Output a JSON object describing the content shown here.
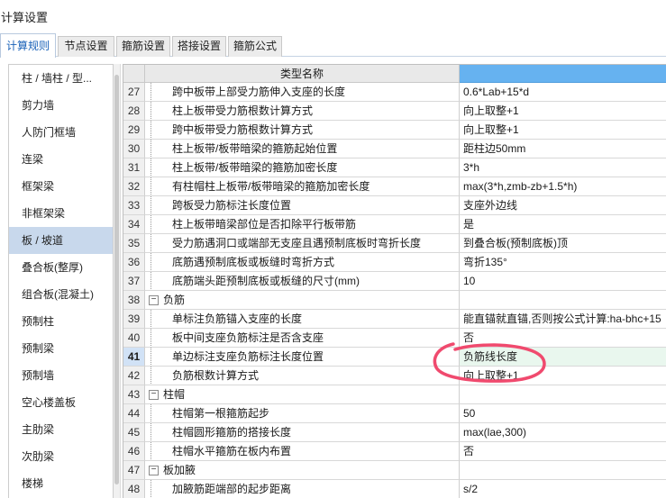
{
  "window": {
    "title": "计算设置"
  },
  "tabs": [
    {
      "label": "计算规则",
      "active": true
    },
    {
      "label": "节点设置",
      "active": false
    },
    {
      "label": "箍筋设置",
      "active": false
    },
    {
      "label": "搭接设置",
      "active": false
    },
    {
      "label": "箍筋公式",
      "active": false
    }
  ],
  "sidebar": {
    "items": [
      {
        "label": "柱 / 墙柱 / 型..."
      },
      {
        "label": "剪力墙"
      },
      {
        "label": "人防门框墙"
      },
      {
        "label": "连梁"
      },
      {
        "label": "框架梁"
      },
      {
        "label": "非框架梁"
      },
      {
        "label": "板 / 坡道",
        "selected": true
      },
      {
        "label": "叠合板(整厚)"
      },
      {
        "label": "组合板(混凝土)"
      },
      {
        "label": "预制柱"
      },
      {
        "label": "预制梁"
      },
      {
        "label": "预制墙"
      },
      {
        "label": "空心楼盖板"
      },
      {
        "label": "主肋梁"
      },
      {
        "label": "次肋梁"
      },
      {
        "label": "楼梯"
      }
    ]
  },
  "grid": {
    "header": {
      "name": "类型名称",
      "value": ""
    },
    "rows": [
      {
        "num": "27",
        "name": "跨中板带上部受力筋伸入支座的长度",
        "value": "0.6*Lab+15*d"
      },
      {
        "num": "28",
        "name": "柱上板带受力筋根数计算方式",
        "value": "向上取整+1"
      },
      {
        "num": "29",
        "name": "跨中板带受力筋根数计算方式",
        "value": "向上取整+1"
      },
      {
        "num": "30",
        "name": "柱上板带/板带暗梁的箍筋起始位置",
        "value": "距柱边50mm"
      },
      {
        "num": "31",
        "name": "柱上板带/板带暗梁的箍筋加密长度",
        "value": "3*h"
      },
      {
        "num": "32",
        "name": "有柱帽柱上板带/板带暗梁的箍筋加密长度",
        "value": "max(3*h,zmb-zb+1.5*h)"
      },
      {
        "num": "33",
        "name": "跨板受力筋标注长度位置",
        "value": "支座外边线"
      },
      {
        "num": "34",
        "name": "柱上板带暗梁部位是否扣除平行板带筋",
        "value": "是"
      },
      {
        "num": "35",
        "name": "受力筋遇洞口或端部无支座且遇预制底板时弯折长度",
        "value": "到叠合板(预制底板)顶"
      },
      {
        "num": "36",
        "name": "底筋遇预制底板或板缝时弯折方式",
        "value": "弯折135°"
      },
      {
        "num": "37",
        "name": "底筋端头距预制底板或板缝的尺寸(mm)",
        "value": "10"
      },
      {
        "num": "38",
        "name": "负筋",
        "value": "",
        "group": true
      },
      {
        "num": "39",
        "name": "单标注负筋锚入支座的长度",
        "value": "能直锚就直锚,否则按公式计算:ha-bhc+15"
      },
      {
        "num": "40",
        "name": "板中间支座负筋标注是否含支座",
        "value": "否"
      },
      {
        "num": "41",
        "name": "单边标注支座负筋标注长度位置",
        "value": "负筋线长度",
        "current": true
      },
      {
        "num": "42",
        "name": "负筋根数计算方式",
        "value": "向上取整+1"
      },
      {
        "num": "43",
        "name": "柱帽",
        "value": "",
        "group": true
      },
      {
        "num": "44",
        "name": "柱帽第一根箍筋起步",
        "value": "50"
      },
      {
        "num": "45",
        "name": "柱帽圆形箍筋的搭接长度",
        "value": "max(lae,300)"
      },
      {
        "num": "46",
        "name": "柱帽水平箍筋在板内布置",
        "value": "否"
      },
      {
        "num": "47",
        "name": "板加腋",
        "value": "",
        "group": true
      },
      {
        "num": "48",
        "name": "加腋筋距端部的起步距离",
        "value": "s/2"
      }
    ]
  },
  "icons": {
    "expander": "−"
  },
  "colors": {
    "header_value_bg": "#66b2f0",
    "selected_row_bg": "#c8d8ec",
    "annotation_stroke": "#f04a6e"
  }
}
